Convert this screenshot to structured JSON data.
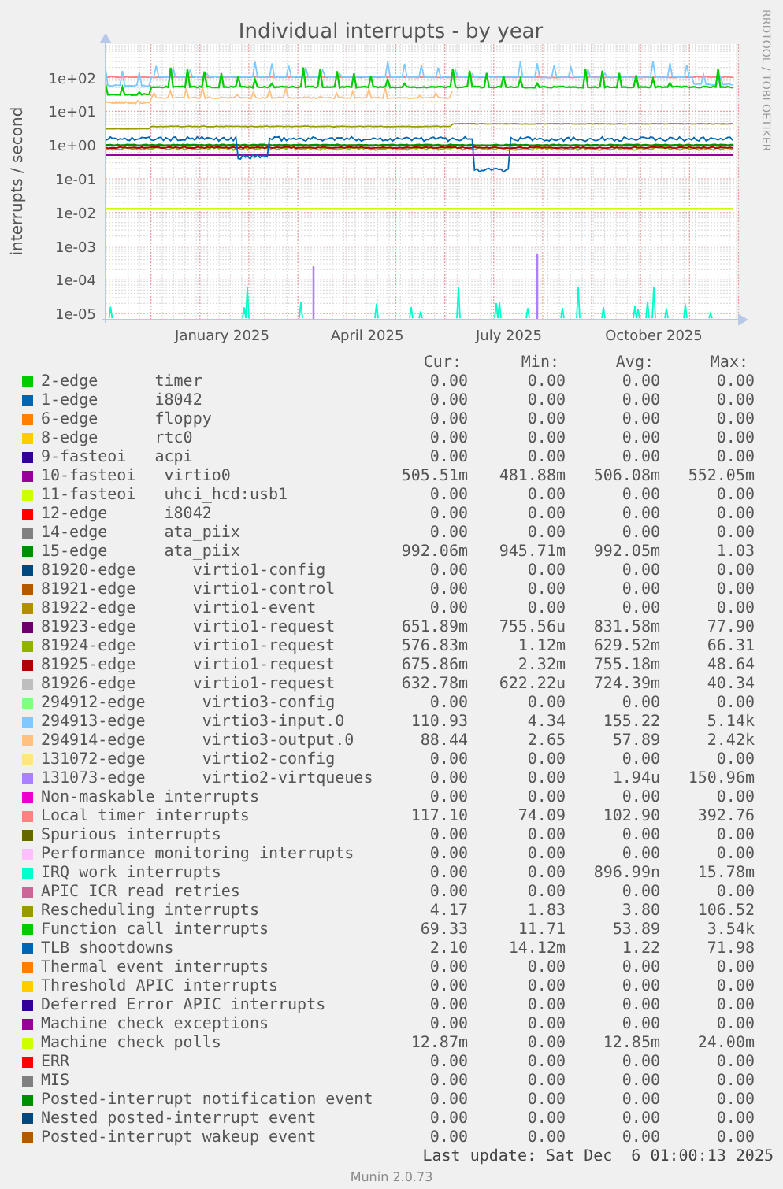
{
  "graph": {
    "title": "Individual interrupts - by year",
    "y_axis_label": "interrupts / second",
    "y_ticks": [
      "1e+02",
      "1e+01",
      "1e+00",
      "1e-01",
      "1e-02",
      "1e-03",
      "1e-04",
      "1e-05"
    ],
    "x_ticks": [
      "January 2025",
      "April 2025",
      "July 2025",
      "October 2025"
    ],
    "credit": "RRDTOOL / TOBI OETIKER"
  },
  "legend": {
    "columns": [
      "Cur:",
      "Min:",
      "Avg:",
      "Max:"
    ],
    "rows": [
      {
        "label": "2-edge      timer",
        "color": "#00cc00",
        "cur": "0.00",
        "min": "0.00",
        "avg": "0.00",
        "max": "0.00"
      },
      {
        "label": "1-edge      i8042",
        "color": "#0066b3",
        "cur": "0.00",
        "min": "0.00",
        "avg": "0.00",
        "max": "0.00"
      },
      {
        "label": "6-edge      floppy",
        "color": "#ff8000",
        "cur": "0.00",
        "min": "0.00",
        "avg": "0.00",
        "max": "0.00"
      },
      {
        "label": "8-edge      rtc0",
        "color": "#ffcc00",
        "cur": "0.00",
        "min": "0.00",
        "avg": "0.00",
        "max": "0.00"
      },
      {
        "label": "9-fasteoi   acpi",
        "color": "#330099",
        "cur": "0.00",
        "min": "0.00",
        "avg": "0.00",
        "max": "0.00"
      },
      {
        "label": "10-fasteoi   virtio0",
        "color": "#990099",
        "cur": "505.51m",
        "min": "481.88m",
        "avg": "506.08m",
        "max": "552.05m"
      },
      {
        "label": "11-fasteoi   uhci_hcd:usb1",
        "color": "#ccff00",
        "cur": "0.00",
        "min": "0.00",
        "avg": "0.00",
        "max": "0.00"
      },
      {
        "label": "12-edge      i8042",
        "color": "#ff0000",
        "cur": "0.00",
        "min": "0.00",
        "avg": "0.00",
        "max": "0.00"
      },
      {
        "label": "14-edge      ata_piix",
        "color": "#808080",
        "cur": "0.00",
        "min": "0.00",
        "avg": "0.00",
        "max": "0.00"
      },
      {
        "label": "15-edge      ata_piix",
        "color": "#008f00",
        "cur": "992.06m",
        "min": "945.71m",
        "avg": "992.05m",
        "max": "1.03"
      },
      {
        "label": "81920-edge      virtio1-config",
        "color": "#00487d",
        "cur": "0.00",
        "min": "0.00",
        "avg": "0.00",
        "max": "0.00"
      },
      {
        "label": "81921-edge      virtio1-control",
        "color": "#b35a00",
        "cur": "0.00",
        "min": "0.00",
        "avg": "0.00",
        "max": "0.00"
      },
      {
        "label": "81922-edge      virtio1-event",
        "color": "#b38f00",
        "cur": "0.00",
        "min": "0.00",
        "avg": "0.00",
        "max": "0.00"
      },
      {
        "label": "81923-edge      virtio1-request",
        "color": "#6b006b",
        "cur": "651.89m",
        "min": "755.56u",
        "avg": "831.58m",
        "max": "77.90"
      },
      {
        "label": "81924-edge      virtio1-request",
        "color": "#8fb300",
        "cur": "576.83m",
        "min": "1.12m",
        "avg": "629.52m",
        "max": "66.31"
      },
      {
        "label": "81925-edge      virtio1-request",
        "color": "#b30000",
        "cur": "675.86m",
        "min": "2.32m",
        "avg": "755.18m",
        "max": "48.64"
      },
      {
        "label": "81926-edge      virtio1-request",
        "color": "#bebebe",
        "cur": "632.78m",
        "min": "622.22u",
        "avg": "724.39m",
        "max": "40.34"
      },
      {
        "label": "294912-edge      virtio3-config",
        "color": "#80ff80",
        "cur": "0.00",
        "min": "0.00",
        "avg": "0.00",
        "max": "0.00"
      },
      {
        "label": "294913-edge      virtio3-input.0",
        "color": "#80c9ff",
        "cur": "110.93",
        "min": "4.34",
        "avg": "155.22",
        "max": "5.14k"
      },
      {
        "label": "294914-edge      virtio3-output.0",
        "color": "#ffc080",
        "cur": "88.44",
        "min": "2.65",
        "avg": "57.89",
        "max": "2.42k"
      },
      {
        "label": "131072-edge      virtio2-config",
        "color": "#ffe680",
        "cur": "0.00",
        "min": "0.00",
        "avg": "0.00",
        "max": "0.00"
      },
      {
        "label": "131073-edge      virtio2-virtqueues",
        "color": "#aa80ff",
        "cur": "0.00",
        "min": "0.00",
        "avg": "1.94u",
        "max": "150.96m"
      },
      {
        "label": "Non-maskable interrupts",
        "color": "#ee00cc",
        "cur": "0.00",
        "min": "0.00",
        "avg": "0.00",
        "max": "0.00"
      },
      {
        "label": "Local timer interrupts",
        "color": "#ff8080",
        "cur": "117.10",
        "min": "74.09",
        "avg": "102.90",
        "max": "392.76"
      },
      {
        "label": "Spurious interrupts",
        "color": "#666600",
        "cur": "0.00",
        "min": "0.00",
        "avg": "0.00",
        "max": "0.00"
      },
      {
        "label": "Performance monitoring interrupts",
        "color": "#ffbfff",
        "cur": "0.00",
        "min": "0.00",
        "avg": "0.00",
        "max": "0.00"
      },
      {
        "label": "IRQ work interrupts",
        "color": "#00ffcc",
        "cur": "0.00",
        "min": "0.00",
        "avg": "896.99n",
        "max": "15.78m"
      },
      {
        "label": "APIC ICR read retries",
        "color": "#cc6699",
        "cur": "0.00",
        "min": "0.00",
        "avg": "0.00",
        "max": "0.00"
      },
      {
        "label": "Rescheduling interrupts",
        "color": "#999900",
        "cur": "4.17",
        "min": "1.83",
        "avg": "3.80",
        "max": "106.52"
      },
      {
        "label": "Function call interrupts",
        "color": "#00cc00",
        "cur": "69.33",
        "min": "11.71",
        "avg": "53.89",
        "max": "3.54k"
      },
      {
        "label": "TLB shootdowns",
        "color": "#0066b3",
        "cur": "2.10",
        "min": "14.12m",
        "avg": "1.22",
        "max": "71.98"
      },
      {
        "label": "Thermal event interrupts",
        "color": "#ff8000",
        "cur": "0.00",
        "min": "0.00",
        "avg": "0.00",
        "max": "0.00"
      },
      {
        "label": "Threshold APIC interrupts",
        "color": "#ffcc00",
        "cur": "0.00",
        "min": "0.00",
        "avg": "0.00",
        "max": "0.00"
      },
      {
        "label": "Deferred Error APIC interrupts",
        "color": "#330099",
        "cur": "0.00",
        "min": "0.00",
        "avg": "0.00",
        "max": "0.00"
      },
      {
        "label": "Machine check exceptions",
        "color": "#990099",
        "cur": "0.00",
        "min": "0.00",
        "avg": "0.00",
        "max": "0.00"
      },
      {
        "label": "Machine check polls",
        "color": "#ccff00",
        "cur": "12.87m",
        "min": "0.00",
        "avg": "12.85m",
        "max": "24.00m"
      },
      {
        "label": "ERR",
        "color": "#ff0000",
        "cur": "0.00",
        "min": "0.00",
        "avg": "0.00",
        "max": "0.00"
      },
      {
        "label": "MIS",
        "color": "#808080",
        "cur": "0.00",
        "min": "0.00",
        "avg": "0.00",
        "max": "0.00"
      },
      {
        "label": "Posted-interrupt notification event",
        "color": "#008f00",
        "cur": "0.00",
        "min": "0.00",
        "avg": "0.00",
        "max": "0.00"
      },
      {
        "label": "Nested posted-interrupt event",
        "color": "#00487d",
        "cur": "0.00",
        "min": "0.00",
        "avg": "0.00",
        "max": "0.00"
      },
      {
        "label": "Posted-interrupt wakeup event",
        "color": "#b35a00",
        "cur": "0.00",
        "min": "0.00",
        "avg": "0.00",
        "max": "0.00"
      }
    ]
  },
  "last_update": "Last update: Sat Dec  6 01:00:13 2025",
  "footer": "Munin 2.0.73"
}
